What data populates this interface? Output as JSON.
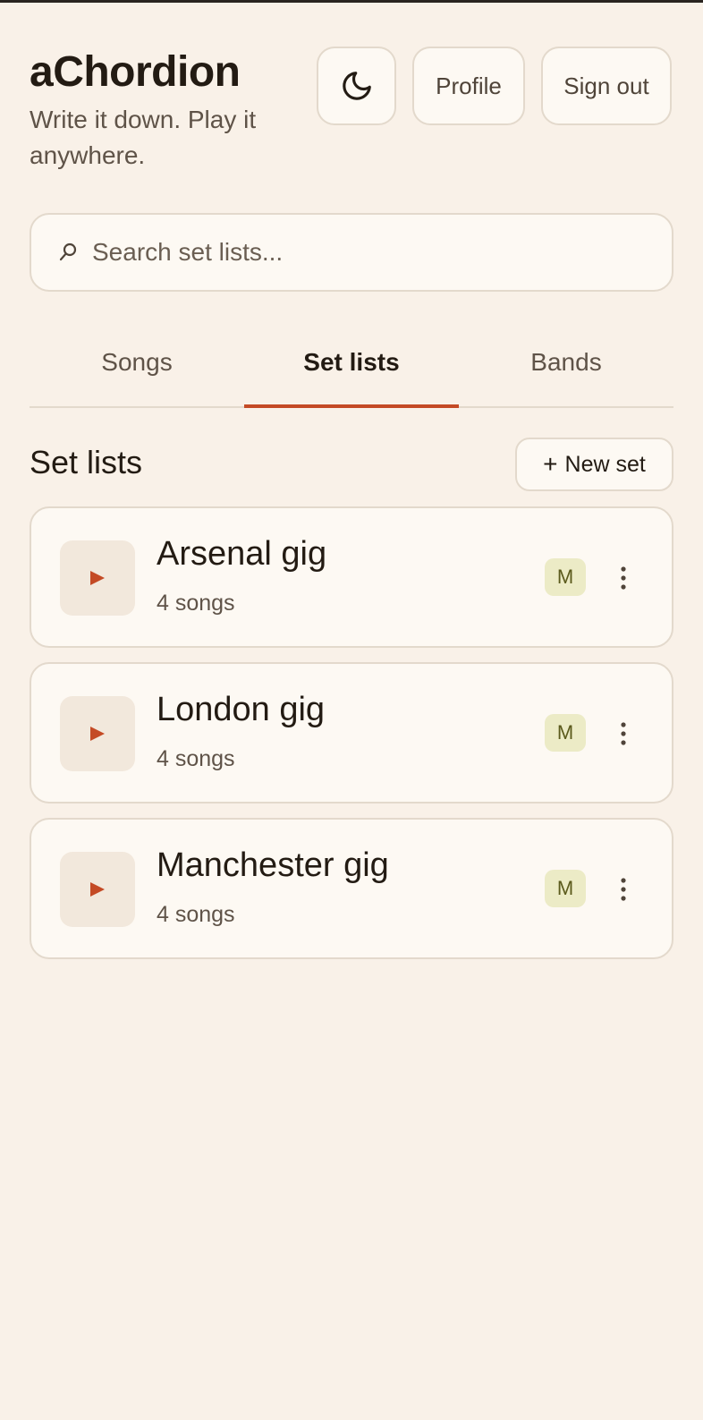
{
  "app": {
    "title": "aChordion",
    "tagline": "Write it down. Play it anywhere."
  },
  "header": {
    "theme_icon": "moon-icon",
    "profile_label": "Profile",
    "signout_label": "Sign out"
  },
  "search": {
    "icon": "search-icon",
    "placeholder": "Search set lists..."
  },
  "tabs": [
    {
      "label": "Songs",
      "active": false
    },
    {
      "label": "Set lists",
      "active": true
    },
    {
      "label": "Bands",
      "active": false
    }
  ],
  "section": {
    "title": "Set lists",
    "new_button_icon": "plus-icon",
    "new_button_label": "New set"
  },
  "setlists": [
    {
      "name": "Arsenal gig",
      "meta": "4 songs",
      "badge": "M"
    },
    {
      "name": "London gig",
      "meta": "4 songs",
      "badge": "M"
    },
    {
      "name": "Manchester gig",
      "meta": "4 songs",
      "badge": "M"
    }
  ],
  "colors": {
    "background": "#f9f1e8",
    "card": "#fdf9f3",
    "accent": "#c44a25",
    "badge_bg": "#ecebc6",
    "border": "#e3d9cc"
  }
}
